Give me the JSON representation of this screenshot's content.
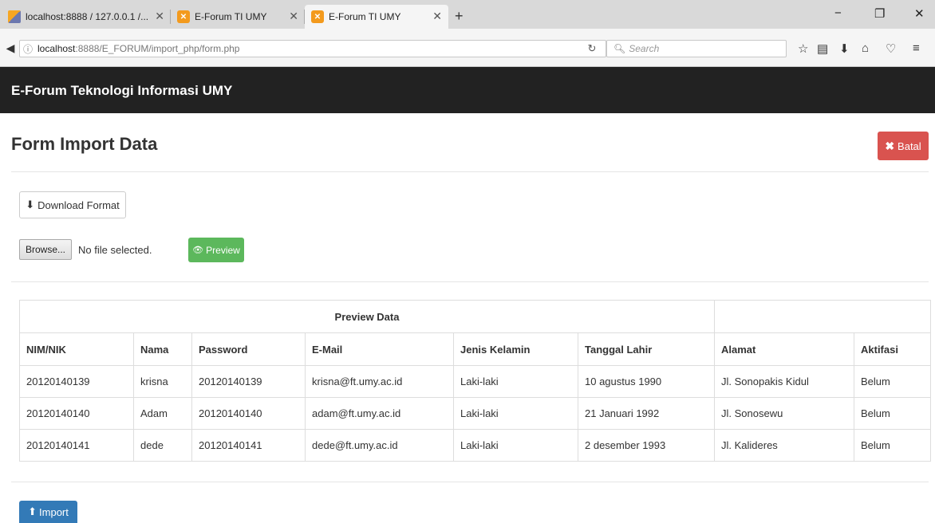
{
  "browser": {
    "tabs": [
      {
        "title": "localhost:8888 / 127.0.0.1 /...",
        "favicon": "phpmyadmin-icon"
      },
      {
        "title": "E-Forum TI UMY",
        "favicon": "xampp-icon"
      },
      {
        "title": "E-Forum TI UMY",
        "favicon": "xampp-icon",
        "active": true
      }
    ],
    "url_host": "localhost",
    "url_path": ":8888/E_FORUM/import_php/form.php",
    "search_placeholder": "Search"
  },
  "site": {
    "brand": "E-Forum Teknologi Informasi UMY"
  },
  "page": {
    "title": "Form Import Data",
    "batal_label": "Batal",
    "download_label": "Download Format",
    "browse_label": "Browse...",
    "file_status": "No file selected.",
    "preview_label": "Preview",
    "import_label": "Import"
  },
  "table": {
    "caption": "Preview Data",
    "headers": [
      "NIM/NIK",
      "Nama",
      "Password",
      "E-Mail",
      "Jenis Kelamin",
      "Tanggal Lahir",
      "Alamat",
      "Aktifasi"
    ],
    "rows": [
      [
        "20120140139",
        "krisna",
        "20120140139",
        "krisna@ft.umy.ac.id",
        "Laki-laki",
        "10 agustus 1990",
        "Jl. Sonopakis Kidul",
        "Belum"
      ],
      [
        "20120140140",
        "Adam",
        "20120140140",
        "adam@ft.umy.ac.id",
        "Laki-laki",
        "21 Januari 1992",
        "Jl. Sonosewu",
        "Belum"
      ],
      [
        "20120140141",
        "dede",
        "20120140141",
        "dede@ft.umy.ac.id",
        "Laki-laki",
        "2 desember 1993",
        "Jl. Kalideres",
        "Belum"
      ]
    ]
  },
  "colors": {
    "navbar": "#222222",
    "danger": "#d9534f",
    "success": "#5cb85c",
    "primary": "#337ab7"
  }
}
